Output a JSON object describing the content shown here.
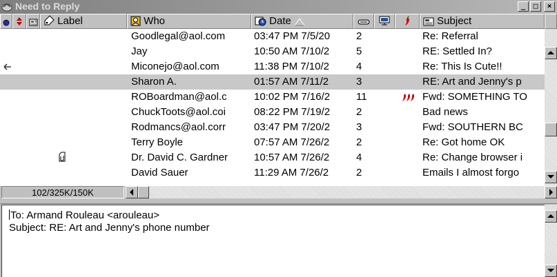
{
  "window": {
    "title": "Need to Reply",
    "controls": {
      "minimize": "_",
      "maximize": "□",
      "close": "×"
    }
  },
  "columns": {
    "status_icon": "status-dot-icon",
    "priority_icon": "priority-icon",
    "attachment_icon": "attachment-icon",
    "label": "Label",
    "who": "Who",
    "date": "Date",
    "size_icon": "size-icon",
    "server_icon": "server-icon",
    "mood_icon": "mood-pepper-icon",
    "subject": "Subject"
  },
  "messages": [
    {
      "who": "Goodlegal@aol.com",
      "date": "03:47 PM 7/5/20",
      "size": "2",
      "subject": "Re: Referral",
      "status": "",
      "attachment": "",
      "mood": "",
      "selected": false
    },
    {
      "who": "Jay",
      "date": "10:50 AM 7/10/2",
      "size": "5",
      "subject": "RE: Settled In?",
      "status": "",
      "attachment": "",
      "mood": "",
      "selected": false
    },
    {
      "who": "Miconejo@aol.com",
      "date": "11:38 PM 7/10/2",
      "size": "4",
      "subject": "Re: This Is Cute!!",
      "status": "replied-arrow",
      "attachment": "",
      "mood": "",
      "selected": false
    },
    {
      "who": "Sharon  A.",
      "date": "01:57 AM 7/11/2",
      "size": "3",
      "subject": "RE: Art and Jenny's p",
      "status": "",
      "attachment": "",
      "mood": "",
      "selected": true
    },
    {
      "who": "ROBoardman@aol.c",
      "date": "10:02 PM 7/16/2",
      "size": "11",
      "subject": "Fwd: SOMETHING TO",
      "status": "",
      "attachment": "",
      "mood": "hot-peppers",
      "selected": false
    },
    {
      "who": "ChuckToots@aol.coi",
      "date": "08:22 PM 7/19/2",
      "size": "2",
      "subject": "Bad news",
      "status": "",
      "attachment": "",
      "mood": "",
      "selected": false
    },
    {
      "who": "Rodmancs@aol.corr",
      "date": "03:47 PM 7/20/2",
      "size": "3",
      "subject": "Fwd: SOUTHERN BC",
      "status": "",
      "attachment": "",
      "mood": "",
      "selected": false
    },
    {
      "who": "Terry Boyle",
      "date": "07:57 AM 7/26/2",
      "size": "2",
      "subject": "Re: Got home OK",
      "status": "",
      "attachment": "",
      "mood": "",
      "selected": false
    },
    {
      "who": "Dr. David C. Gardner",
      "date": "10:57 AM 7/26/2",
      "size": "4",
      "subject": "Re: Change browser i",
      "status": "",
      "attachment": "attachment",
      "mood": "",
      "selected": false
    },
    {
      "who": "David Sauer",
      "date": "11:29 AM 7/26/2",
      "size": "2",
      "subject": "Emails I almost forgo",
      "status": "",
      "attachment": "",
      "mood": "",
      "selected": false
    }
  ],
  "status_bar": {
    "text": "102/325K/150K"
  },
  "preview": {
    "to_line": "To: Armand Rouleau <arouleau>",
    "subject_line": "Subject: RE: Art and Jenny's phone number"
  },
  "colors": {
    "selected_row": "#c8c8c8",
    "chrome": "#c0c0c0",
    "pepper": "#cc0000"
  }
}
